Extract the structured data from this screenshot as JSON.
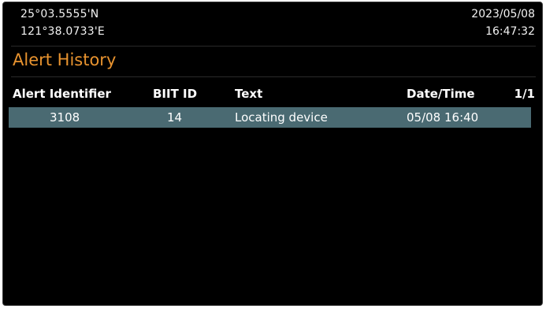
{
  "status": {
    "latitude": "25°03.5555'N",
    "longitude": "121°38.0733'E",
    "date": "2023/05/08",
    "time": "16:47:32"
  },
  "page": {
    "title": "Alert History"
  },
  "table": {
    "columns": {
      "alert_identifier": "Alert Identifier",
      "biit_id": "BIIT ID",
      "text": "Text",
      "date_time": "Date/Time"
    },
    "page_indicator": "1/1",
    "rows": [
      {
        "alert_identifier": "3108",
        "biit_id": "14",
        "text": "Locating device",
        "date_time": "05/08 16:40"
      }
    ]
  },
  "colors": {
    "background": "#000000",
    "title_accent": "#e8932f",
    "selected_row": "#4a6a72",
    "text": "#ffffff"
  }
}
